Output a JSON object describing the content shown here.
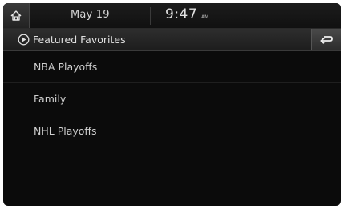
{
  "status_bar": {
    "date": "May 19",
    "time": "9:47",
    "ampm": "AM"
  },
  "header": {
    "title": "Featured Favorites"
  },
  "list": {
    "items": [
      {
        "label": "NBA Playoffs"
      },
      {
        "label": "Family"
      },
      {
        "label": "NHL Playoffs"
      }
    ]
  },
  "icons": {
    "home": "home-icon",
    "play": "play-circle-icon",
    "back": "back-arrow-icon"
  }
}
